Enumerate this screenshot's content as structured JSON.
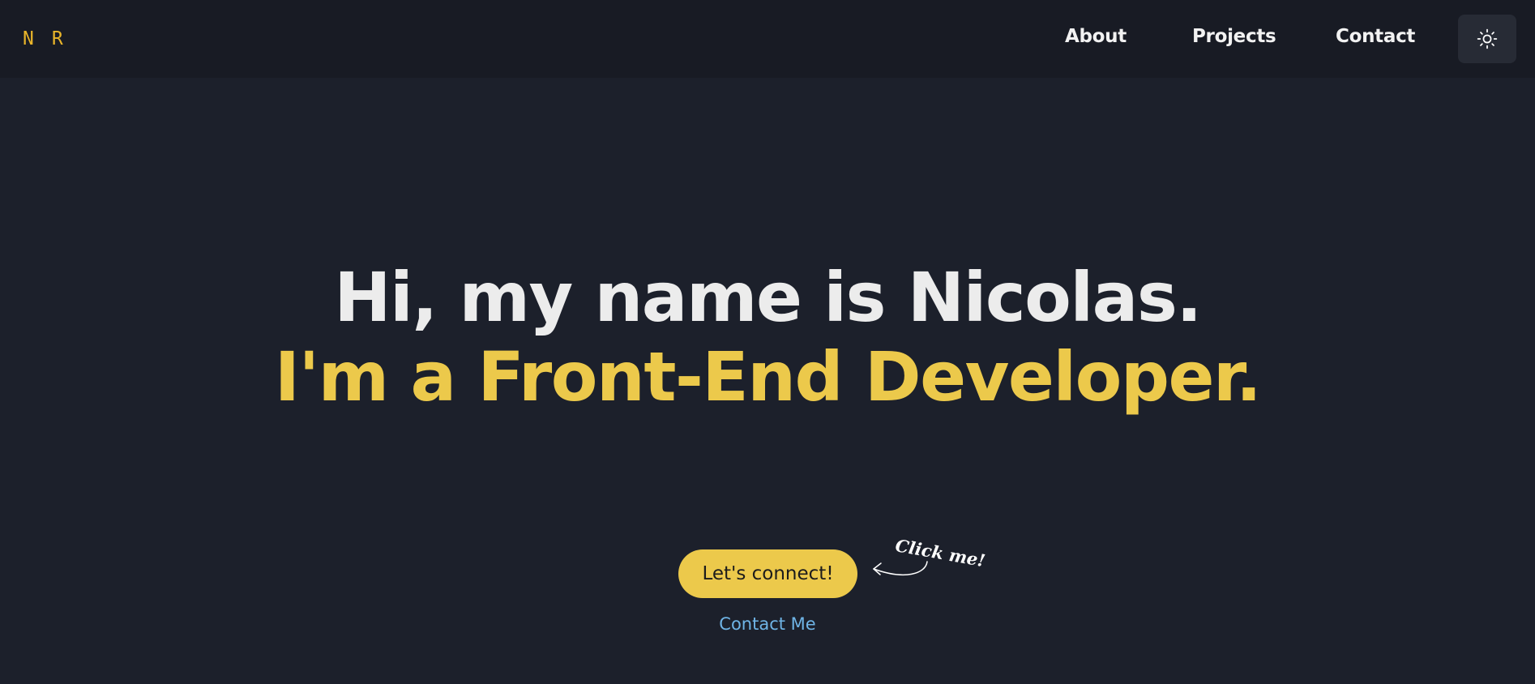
{
  "nav": {
    "logo_first": "N",
    "logo_second": "R",
    "links": [
      "About",
      "Projects",
      "Contact"
    ],
    "theme_toggle_icon": "sun-icon"
  },
  "hero": {
    "greeting": "Hi, my name is Nicolas.",
    "role": "I'm a Front-End Developer.",
    "cta_label": "Let's connect!",
    "cta_hint": "Click me!",
    "contact_link": "Contact Me"
  },
  "colors": {
    "background": "#1c202b",
    "navbar": "#181b24",
    "accent": "#ecc94b",
    "logo": "#e9b52a",
    "link": "#6fb4e6",
    "text": "#ececec"
  }
}
